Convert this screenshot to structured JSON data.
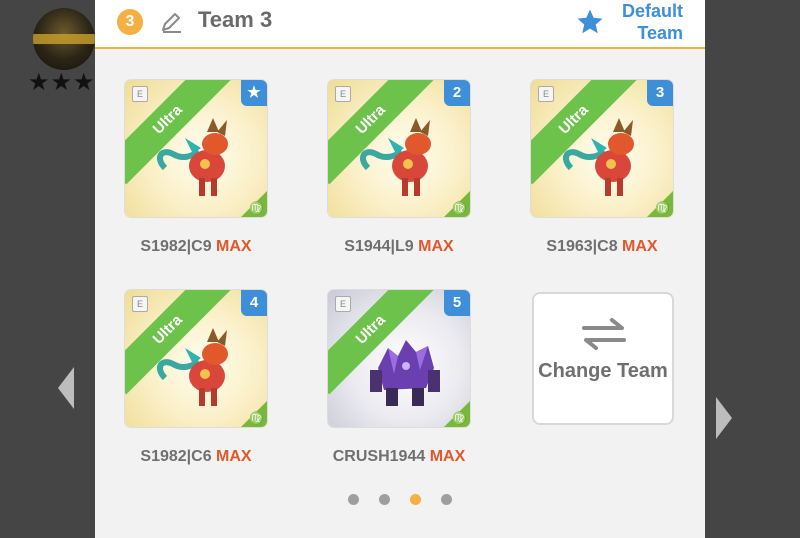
{
  "player": {
    "stars": "★★★"
  },
  "header": {
    "team_number": "3",
    "title": "Team 3",
    "default_label": "Default Team",
    "accent": "#f4b043"
  },
  "cards": [
    {
      "rarity": "Ultra",
      "slot": "★",
      "name": "S1982|C9",
      "level": "MAX",
      "creature": "red-dragon"
    },
    {
      "rarity": "Ultra",
      "slot": "2",
      "name": "S1944|L9",
      "level": "MAX",
      "creature": "red-dragon"
    },
    {
      "rarity": "Ultra",
      "slot": "3",
      "name": "S1963|C8",
      "level": "MAX",
      "creature": "red-dragon"
    },
    {
      "rarity": "Ultra",
      "slot": "4",
      "name": "S1982|C6",
      "level": "MAX",
      "creature": "red-dragon"
    },
    {
      "rarity": "Ultra",
      "slot": "5",
      "name": "CRUSH1944",
      "level": "MAX",
      "creature": "purple-crystal-golem"
    }
  ],
  "change_team": {
    "label": "Change Team"
  },
  "pagination": {
    "total": 4,
    "active": 3
  },
  "colors": {
    "ribbon": "#6cc24a",
    "slot_badge": "#3e8fd8",
    "max": "#e0582b"
  }
}
